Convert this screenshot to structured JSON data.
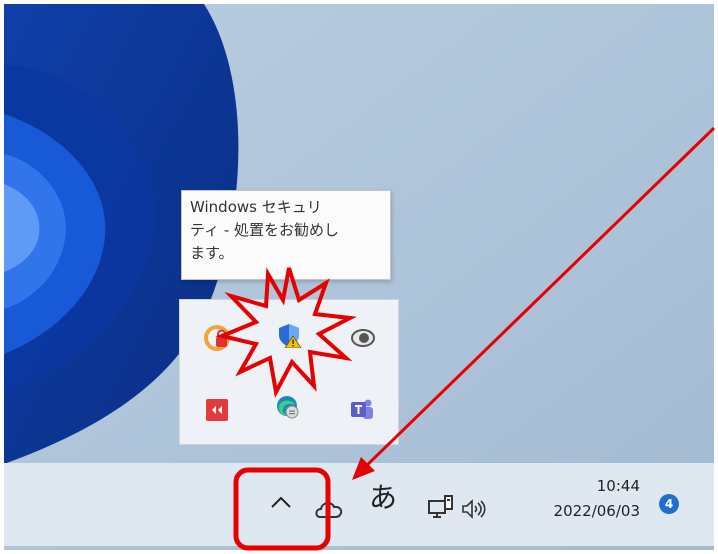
{
  "tooltip": {
    "text": "Windows セキュリ\nティ - 処置をお勧めし\nます。"
  },
  "hidden_tray": {
    "icons": [
      {
        "icon": "vpn-lock-icon",
        "color": "#f0a43a"
      },
      {
        "icon": "windows-security-warning-icon",
        "color": "#2a6ad8"
      },
      {
        "icon": "eye-icon",
        "color": "#555555"
      },
      {
        "icon": "remote-app-icon",
        "color": "#e23b3b"
      },
      {
        "icon": "edge-icon",
        "color": "#1d86c9"
      },
      {
        "icon": "teams-icon",
        "color": "#5b5fc7"
      }
    ]
  },
  "taskbar": {
    "chevron": "^",
    "ime_mode": "あ",
    "clock_time": "10:44",
    "clock_date": "2022/06/03",
    "notification_count": "4"
  },
  "annotation": {
    "highlight_color": "#e60000",
    "arrow_color": "#e60000"
  }
}
